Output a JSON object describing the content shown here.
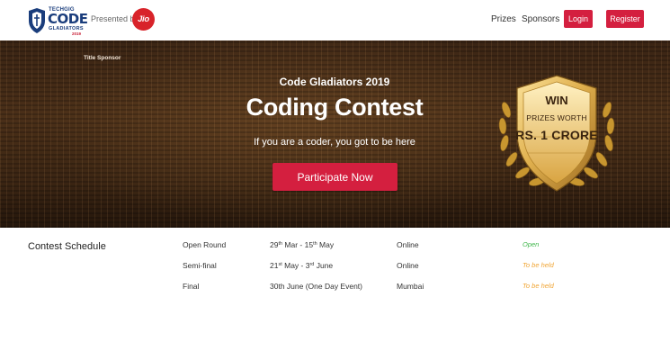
{
  "header": {
    "logo": {
      "prefix": "TECHGIG",
      "wordmark": "CODE",
      "subtitle": "GLADIATORS",
      "year": "2019"
    },
    "presented_by": "Presented by",
    "sponsor_logo_text": "Jio",
    "nav": {
      "prizes": "Prizes",
      "sponsors": "Sponsors",
      "login": "Login",
      "register": "Register"
    }
  },
  "hero": {
    "title_sponsor_label": "Title Sponsor",
    "eyebrow": "Code Gladiators 2019",
    "title": "Coding Contest",
    "tagline": "If you are a coder, you got to be here",
    "cta_label": "Participate Now",
    "badge": {
      "line1": "WIN",
      "line2": "PRIZES WORTH",
      "line3": "RS. 1 CRORE"
    }
  },
  "schedule": {
    "heading": "Contest Schedule",
    "rows": [
      {
        "round": "Open Round",
        "start_day": "29",
        "start_sup": "th",
        "start_month": " Mar - ",
        "end_day": "15",
        "end_sup": "th",
        "end_month": " May",
        "venue": "Online",
        "status": "Open"
      },
      {
        "round": "Semi-final",
        "start_day": "21",
        "start_sup": "st",
        "start_month": " May - ",
        "end_day": "3",
        "end_sup": "rd",
        "end_month": " June",
        "venue": "Online",
        "status": "To be held"
      },
      {
        "round": "Final",
        "date_text": "30th June (One Day Event)",
        "venue": "Mumbai",
        "status": "To be held"
      }
    ]
  },
  "colors": {
    "accent_red": "#d41f3f",
    "status_open": "#3fb64a",
    "status_upcoming": "#f0a432",
    "hero_brown": "#3a2414"
  },
  "icons": {
    "logo": "code-gladiators-shield-icon",
    "badge": "gold-shield-laurel-icon"
  }
}
